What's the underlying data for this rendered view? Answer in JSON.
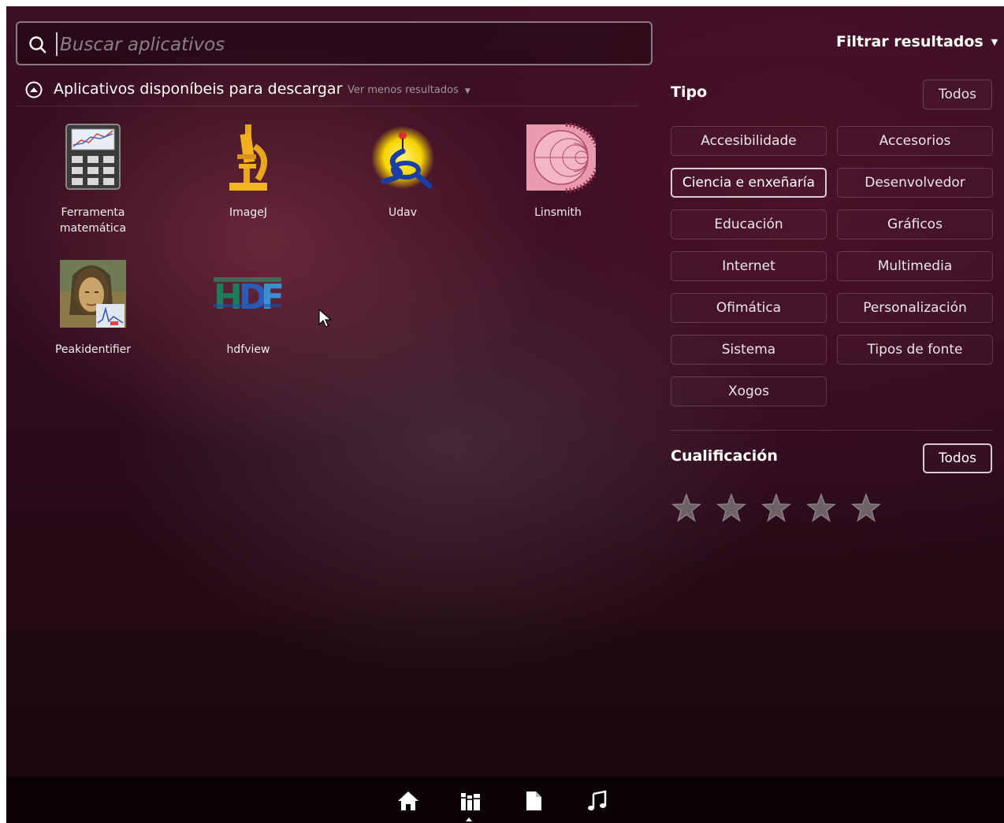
{
  "search": {
    "placeholder": "Buscar aplicativos",
    "value": ""
  },
  "filter_toggle": {
    "label": "Filtrar resultados"
  },
  "category": {
    "title": "Aplicativos disponíbeis para descargar",
    "toggle_label": "Ver menos resultados"
  },
  "apps": [
    {
      "name": "Ferramenta\nmatemática",
      "icon": "calculator-graph-icon"
    },
    {
      "name": "ImageJ",
      "icon": "microscope-icon"
    },
    {
      "name": "Udav",
      "icon": "udav-icon"
    },
    {
      "name": "Linsmith",
      "icon": "smith-chart-icon"
    },
    {
      "name": "Peakidentifier",
      "icon": "painting-icon"
    },
    {
      "name": "hdfview",
      "icon": "hdf-logo-icon"
    }
  ],
  "filters": {
    "type": {
      "title": "Tipo",
      "all_label": "Todos",
      "all_active": false,
      "options": [
        {
          "label": "Accesibilidade",
          "active": false
        },
        {
          "label": "Accesorios",
          "active": false
        },
        {
          "label": "Ciencia e enxeñaría",
          "active": true
        },
        {
          "label": "Desenvolvedor",
          "active": false
        },
        {
          "label": "Educación",
          "active": false
        },
        {
          "label": "Gráficos",
          "active": false
        },
        {
          "label": "Internet",
          "active": false
        },
        {
          "label": "Multimedia",
          "active": false
        },
        {
          "label": "Ofimática",
          "active": false
        },
        {
          "label": "Personalización",
          "active": false
        },
        {
          "label": "Sistema",
          "active": false
        },
        {
          "label": "Tipos de fonte",
          "active": false
        },
        {
          "label": "Xogos",
          "active": false
        }
      ]
    },
    "rating": {
      "title": "Cualificación",
      "all_label": "Todos",
      "all_active": true,
      "stars_total": 5,
      "stars_selected": 0
    }
  },
  "lenses": [
    {
      "name": "home-lens-icon",
      "active": false
    },
    {
      "name": "applications-lens-icon",
      "active": true
    },
    {
      "name": "files-lens-icon",
      "active": false
    },
    {
      "name": "music-lens-icon",
      "active": false
    }
  ],
  "colors": {
    "background": "#2e0c1d",
    "text": "#ffffff",
    "muted_text": "#a2939a",
    "active_border": "#d6ced3"
  }
}
